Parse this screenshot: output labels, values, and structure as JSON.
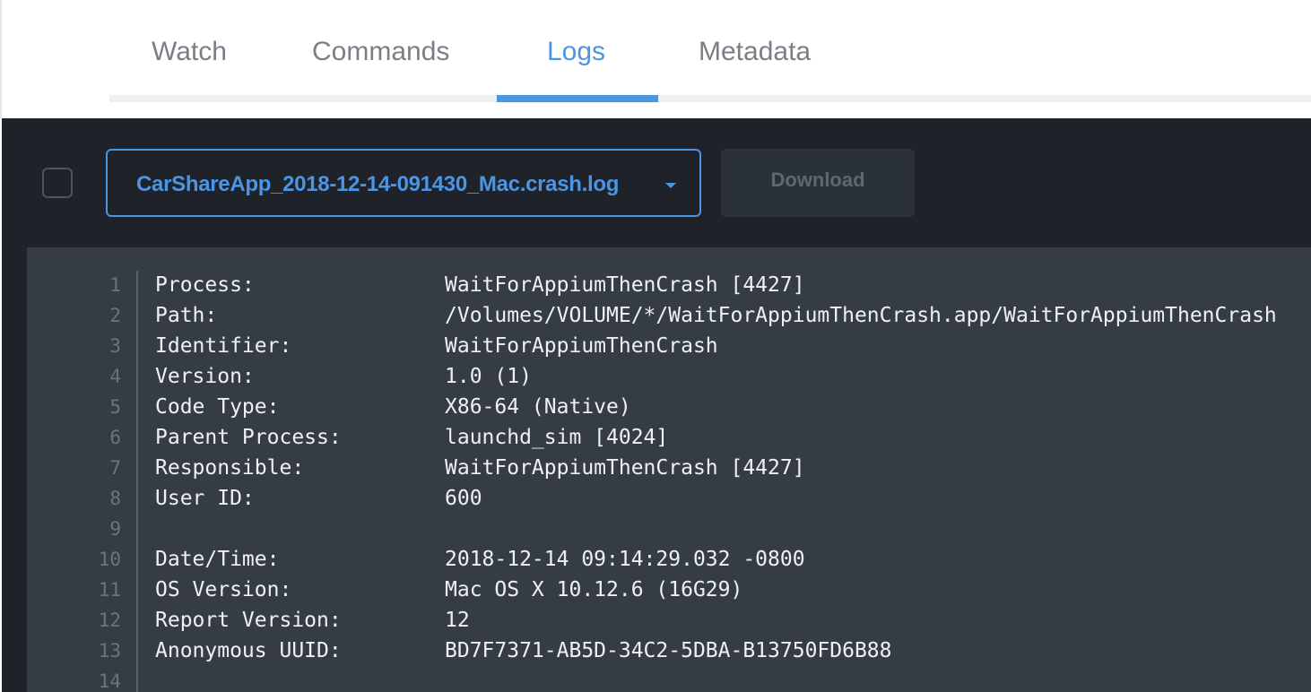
{
  "tabs": [
    {
      "label": "Watch"
    },
    {
      "label": "Commands"
    },
    {
      "label": "Logs"
    },
    {
      "label": "Metadata"
    }
  ],
  "active_tab": "Logs",
  "colors": {
    "accent": "#4a95e4",
    "panel_bg": "#1f2329",
    "log_bg": "#353c45"
  },
  "toolbar": {
    "selected_log": "CarShareApp_2018-12-14-091430_Mac.crash.log",
    "download_label": "Download"
  },
  "log": {
    "lines": [
      {
        "n": "1",
        "key": "Process:",
        "value": "WaitForAppiumThenCrash [4427]"
      },
      {
        "n": "2",
        "key": "Path:",
        "value": "/Volumes/VOLUME/*/WaitForAppiumThenCrash.app/WaitForAppiumThenCrash"
      },
      {
        "n": "3",
        "key": "Identifier:",
        "value": "WaitForAppiumThenCrash"
      },
      {
        "n": "4",
        "key": "Version:",
        "value": "1.0 (1)"
      },
      {
        "n": "5",
        "key": "Code Type:",
        "value": "X86-64 (Native)"
      },
      {
        "n": "6",
        "key": "Parent Process:",
        "value": "launchd_sim [4024]"
      },
      {
        "n": "7",
        "key": "Responsible:",
        "value": "WaitForAppiumThenCrash [4427]"
      },
      {
        "n": "8",
        "key": "User ID:",
        "value": "600"
      },
      {
        "n": "9",
        "key": "",
        "value": ""
      },
      {
        "n": "10",
        "key": "Date/Time:",
        "value": "2018-12-14 09:14:29.032 -0800"
      },
      {
        "n": "11",
        "key": "OS Version:",
        "value": "Mac OS X 10.12.6 (16G29)"
      },
      {
        "n": "12",
        "key": "Report Version:",
        "value": "12"
      },
      {
        "n": "13",
        "key": "Anonymous UUID:",
        "value": "BD7F7371-AB5D-34C2-5DBA-B13750FD6B88"
      },
      {
        "n": "14",
        "key": "",
        "value": ""
      }
    ]
  }
}
